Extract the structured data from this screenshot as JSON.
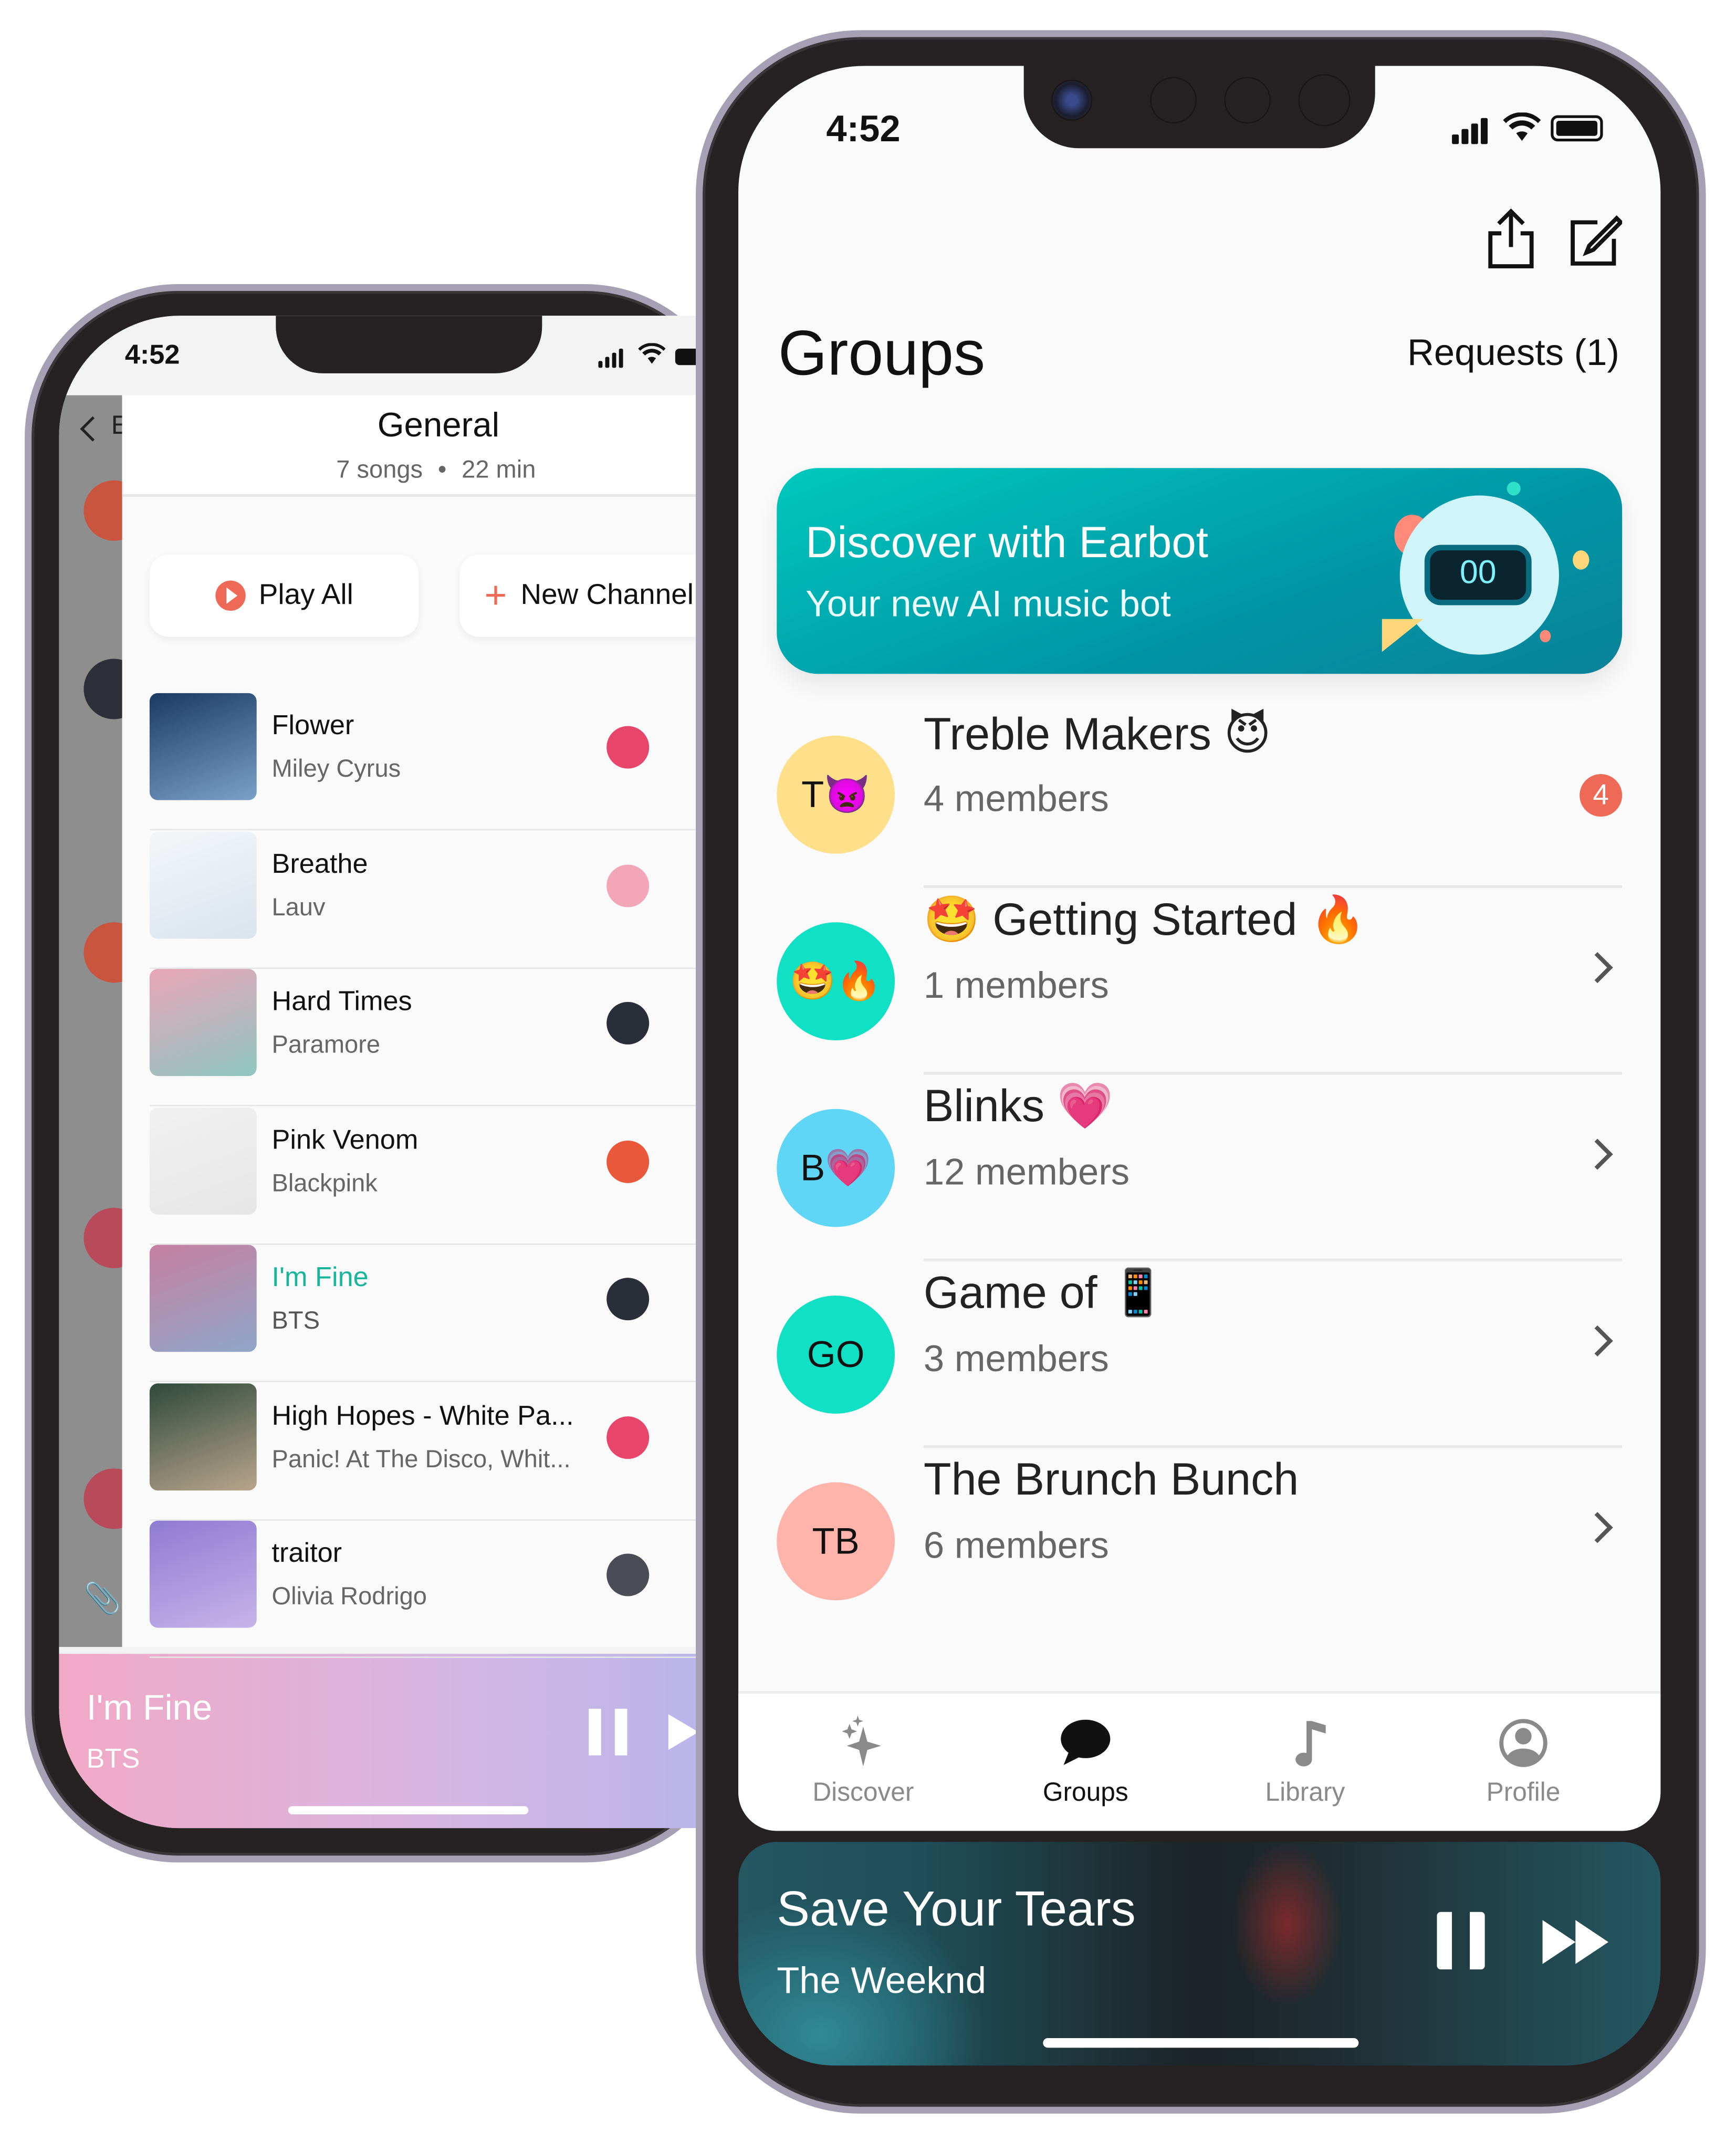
{
  "left_phone": {
    "status_time": "4:52",
    "back_label": "E",
    "header": {
      "title": "General",
      "song_count": "7 songs",
      "separator": "•",
      "duration": "22 min"
    },
    "buttons": {
      "play_all": "Play All",
      "new_channel": "New Channel"
    },
    "songs": [
      {
        "title": "Flower",
        "artist": "Miley Cyrus",
        "art_colors": [
          "#1b3a63",
          "#7aa0c9"
        ],
        "avatar_color": "#e8456a"
      },
      {
        "title": "Breathe",
        "artist": "Lauv",
        "art_colors": [
          "#f4f6f8",
          "#d9e4ee"
        ],
        "avatar_color": "#f2a6b8"
      },
      {
        "title": "Hard Times",
        "artist": "Paramore",
        "art_colors": [
          "#e9a5b8",
          "#8fc7c0"
        ],
        "avatar_color": "#2a2e38"
      },
      {
        "title": "Pink Venom",
        "artist": "Blackpink",
        "art_colors": [
          "#f1f1f1",
          "#e6e6e6"
        ],
        "avatar_color": "#e9583a"
      },
      {
        "title": "I'm Fine",
        "artist": "BTS",
        "art_colors": [
          "#c77fa0",
          "#8fa7c9"
        ],
        "avatar_color": "#2a2e38",
        "playing": true
      },
      {
        "title": "High Hopes - White Pa...",
        "artist": "Panic! At The Disco, Whit...",
        "art_colors": [
          "#2f4a3c",
          "#b8a48b"
        ],
        "avatar_color": "#e8456a"
      },
      {
        "title": "traitor",
        "artist": "Olivia Rodrigo",
        "art_colors": [
          "#8d7bd1",
          "#c7b3ea"
        ],
        "avatar_color": "#4a4d55"
      }
    ],
    "now_playing": {
      "title": "I'm Fine",
      "artist": "BTS"
    }
  },
  "right_phone": {
    "status_time": "4:52",
    "title": "Groups",
    "requests_label": "Requests (1)",
    "banner": {
      "title": "Discover with Earbot",
      "subtitle": "Your new AI music bot"
    },
    "groups": [
      {
        "avatar_text": "T👿",
        "avatar_color": "#ffe08a",
        "name": "Treble Makers 😈",
        "members": "4 members",
        "badge": "4"
      },
      {
        "avatar_text": "🤩🔥",
        "avatar_color": "#10e0c4",
        "name": "🤩 Getting Started 🔥",
        "members": "1 members"
      },
      {
        "avatar_text": "B💗",
        "avatar_color": "#5fd6f5",
        "name": "Blinks 💗",
        "members": "12 members"
      },
      {
        "avatar_text": "GO",
        "avatar_color": "#10e0c4",
        "name": "Game of 📱",
        "members": "3 members"
      },
      {
        "avatar_text": "TB",
        "avatar_color": "#ffb4ab",
        "name": "The Brunch Bunch",
        "members": "6 members"
      }
    ],
    "tabs": [
      {
        "label": "Discover",
        "icon": "sparkles-icon"
      },
      {
        "label": "Groups",
        "icon": "chat-bubble-icon",
        "active": true
      },
      {
        "label": "Library",
        "icon": "music-note-icon"
      },
      {
        "label": "Profile",
        "icon": "person-circle-icon"
      }
    ],
    "now_playing": {
      "title": "Save Your Tears",
      "artist": "The Weeknd"
    }
  },
  "colors": {
    "accent": "#ee6a57",
    "teal": "#00b5b0",
    "playing_text": "#17b59a"
  }
}
